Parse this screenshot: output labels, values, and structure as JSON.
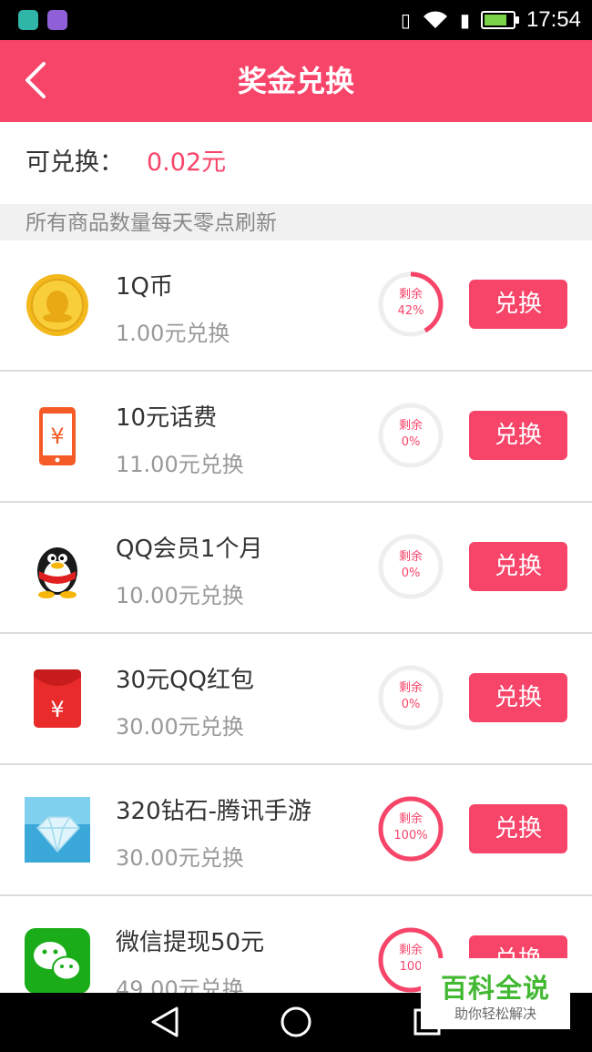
{
  "status_bar": {
    "time": "17:54"
  },
  "header": {
    "title": "奖金兑换"
  },
  "balance": {
    "label": "可兑换：",
    "value": "0.02元"
  },
  "notice": "所有商品数量每天零点刷新",
  "items": [
    {
      "name": "1Q币",
      "price": "1.00元兑换",
      "remaining_label": "剩余",
      "remaining_text": "42%",
      "remaining": 0.42,
      "button": "兑换",
      "icon": "q-coin-icon"
    },
    {
      "name": "10元话费",
      "price": "11.00元兑换",
      "remaining_label": "剩余",
      "remaining_text": "0%",
      "remaining": 0,
      "button": "兑换",
      "icon": "phone-credit-icon"
    },
    {
      "name": "QQ会员1个月",
      "price": "10.00元兑换",
      "remaining_label": "剩余",
      "remaining_text": "0%",
      "remaining": 0,
      "button": "兑换",
      "icon": "qq-penguin-icon"
    },
    {
      "name": "30元QQ红包",
      "price": "30.00元兑换",
      "remaining_label": "剩余",
      "remaining_text": "0%",
      "remaining": 0,
      "button": "兑换",
      "icon": "red-envelope-icon"
    },
    {
      "name": "320钻石-腾讯手游",
      "price": "30.00元兑换",
      "remaining_label": "剩余",
      "remaining_text": "100%",
      "remaining": 1,
      "button": "兑换",
      "icon": "diamond-icon"
    },
    {
      "name": "微信提现50元",
      "price": "49.00元兑换",
      "remaining_label": "剩余",
      "remaining_text": "100",
      "remaining": 1,
      "button": "兑换",
      "icon": "wechat-icon"
    }
  ],
  "watermark": {
    "title": "百科全说",
    "subtitle": "助你轻松解决"
  },
  "colors": {
    "accent": "#f7456a",
    "ring_track": "#eeeeee",
    "watermark_green": "#43b833"
  }
}
